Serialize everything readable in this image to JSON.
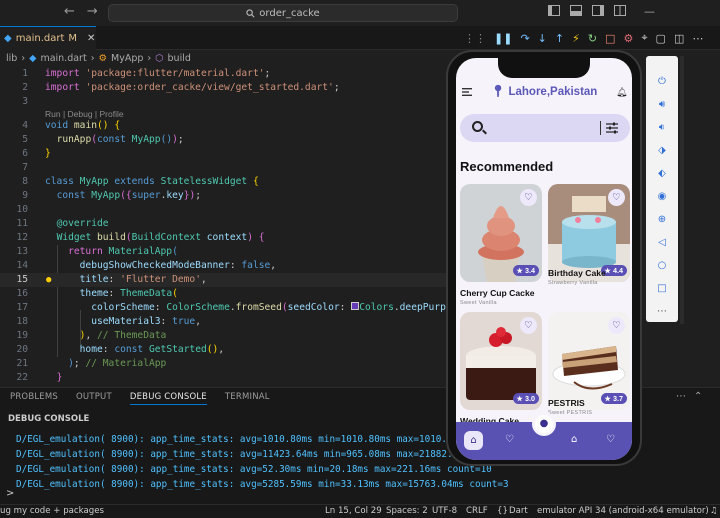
{
  "titlebar": {
    "search_text": "order_cacke",
    "back_arrow": "←",
    "forward_arrow": "→"
  },
  "tabs": [
    {
      "label": "main.dart",
      "badge": "M"
    }
  ],
  "breadcrumb": {
    "root": "lib",
    "file": "main.dart",
    "class": "MyApp",
    "method": "build"
  },
  "code": {
    "codelens": "Run | Debug | Profile",
    "line_numbers": [
      "1",
      "2",
      "3",
      "4",
      "5",
      "6",
      "7",
      "8",
      "9",
      "10",
      "11",
      "12",
      "13",
      "14",
      "15",
      "16",
      "17",
      "18",
      "19",
      "20",
      "21",
      "22"
    ],
    "imports": [
      "'package:flutter/material.dart'",
      "'package:order_cacke/view/get_started.dart'"
    ],
    "title_value": "'Flutter Demo'",
    "comment_theme": "// ThemeData",
    "comment_app": "// MaterialApp"
  },
  "panel": {
    "tabs": [
      "PROBLEMS",
      "OUTPUT",
      "DEBUG CONSOLE",
      "TERMINAL"
    ],
    "active_tab": "DEBUG CONSOLE",
    "title": "DEBUG CONSOLE",
    "console_lines": [
      "D/EGL_emulation( 8900): app_time_stats: avg=1010.80ms min=1010.80ms max=1010.",
      "D/EGL_emulation( 8900): app_time_stats: avg=11423.64ms min=965.08ms max=21882.",
      "D/EGL_emulation( 8900): app_time_stats: avg=52.30ms min=20.18ms max=221.16ms count=10",
      "D/EGL_emulation( 8900): app_time_stats: avg=5285.59ms min=33.13ms max=15763.04ms count=3"
    ],
    "prompt": ">"
  },
  "statusbar": {
    "left": "ug my code + packages",
    "position": "Ln 15, Col 29",
    "spaces": "Spaces: 2",
    "encoding": "UTF-8",
    "eol": "CRLF",
    "braces": "{}",
    "language": "Dart",
    "device": "emulator API 34 (android-x64 emulator)"
  },
  "app": {
    "location": "Lahore,Pakistan",
    "section_title": "Recommended",
    "products": [
      {
        "name": "Cherry Cup Cacke",
        "subtitle": "Sweet Vanilla",
        "rating": "3.4"
      },
      {
        "name": "Birthday Cake",
        "subtitle": "Strawberry Vanilla",
        "rating": "4.4"
      },
      {
        "name": "Wedding Cake",
        "subtitle": "",
        "rating": "3.0"
      },
      {
        "name": "PESTRIS",
        "subtitle": "Sweet PESTRIS",
        "rating": "3.7"
      }
    ],
    "colors": {
      "accent": "#5a52b3",
      "search_bg": "#dcd8f3",
      "background": "#f6f3fb"
    }
  }
}
